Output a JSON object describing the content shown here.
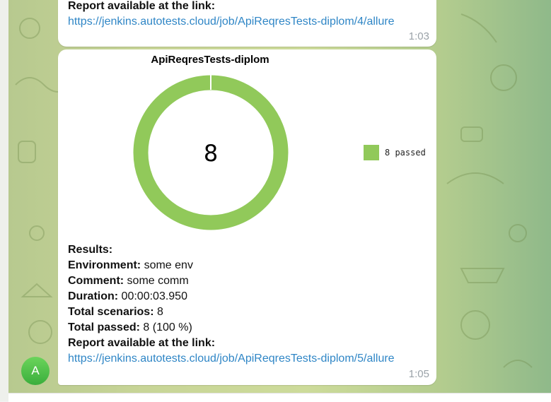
{
  "messages": [
    {
      "report_label": "Report available at the link:",
      "link": "https://jenkins.autotests.cloud/job/ApiReqresTests-diplom/4/allure",
      "time": "1:03"
    },
    {
      "chart_title": "ApiReqresTests-diplom",
      "chart_center_value": "8",
      "legend_label": "8 passed",
      "results_label": "Results:",
      "environment_label": "Environment:",
      "environment_value": " some env",
      "comment_label": "Comment:",
      "comment_value": " some comm",
      "duration_label": "Duration:",
      "duration_value": " 00:00:03.950",
      "total_scenarios_label": "Total scenarios:",
      "total_scenarios_value": " 8",
      "total_passed_label": "Total passed:",
      "total_passed_value": " 8 (100 %)",
      "report_label": "Report available at the link:",
      "link": "https://jenkins.autotests.cloud/job/ApiReqresTests-diplom/5/allure",
      "time": "1:05"
    }
  ],
  "avatar": {
    "initial": "A",
    "color": "#4cbf45"
  },
  "chart_data": {
    "type": "pie",
    "title": "ApiReqresTests-diplom",
    "series": [
      {
        "name": "passed",
        "values": [
          8
        ]
      }
    ],
    "categories": [
      "8 passed"
    ],
    "center_label": "8",
    "legend_position": "right",
    "colors": [
      "#91c95a"
    ]
  },
  "colors": {
    "link": "#2f86c6",
    "passed": "#91c95a",
    "time": "#9aa2a8"
  }
}
